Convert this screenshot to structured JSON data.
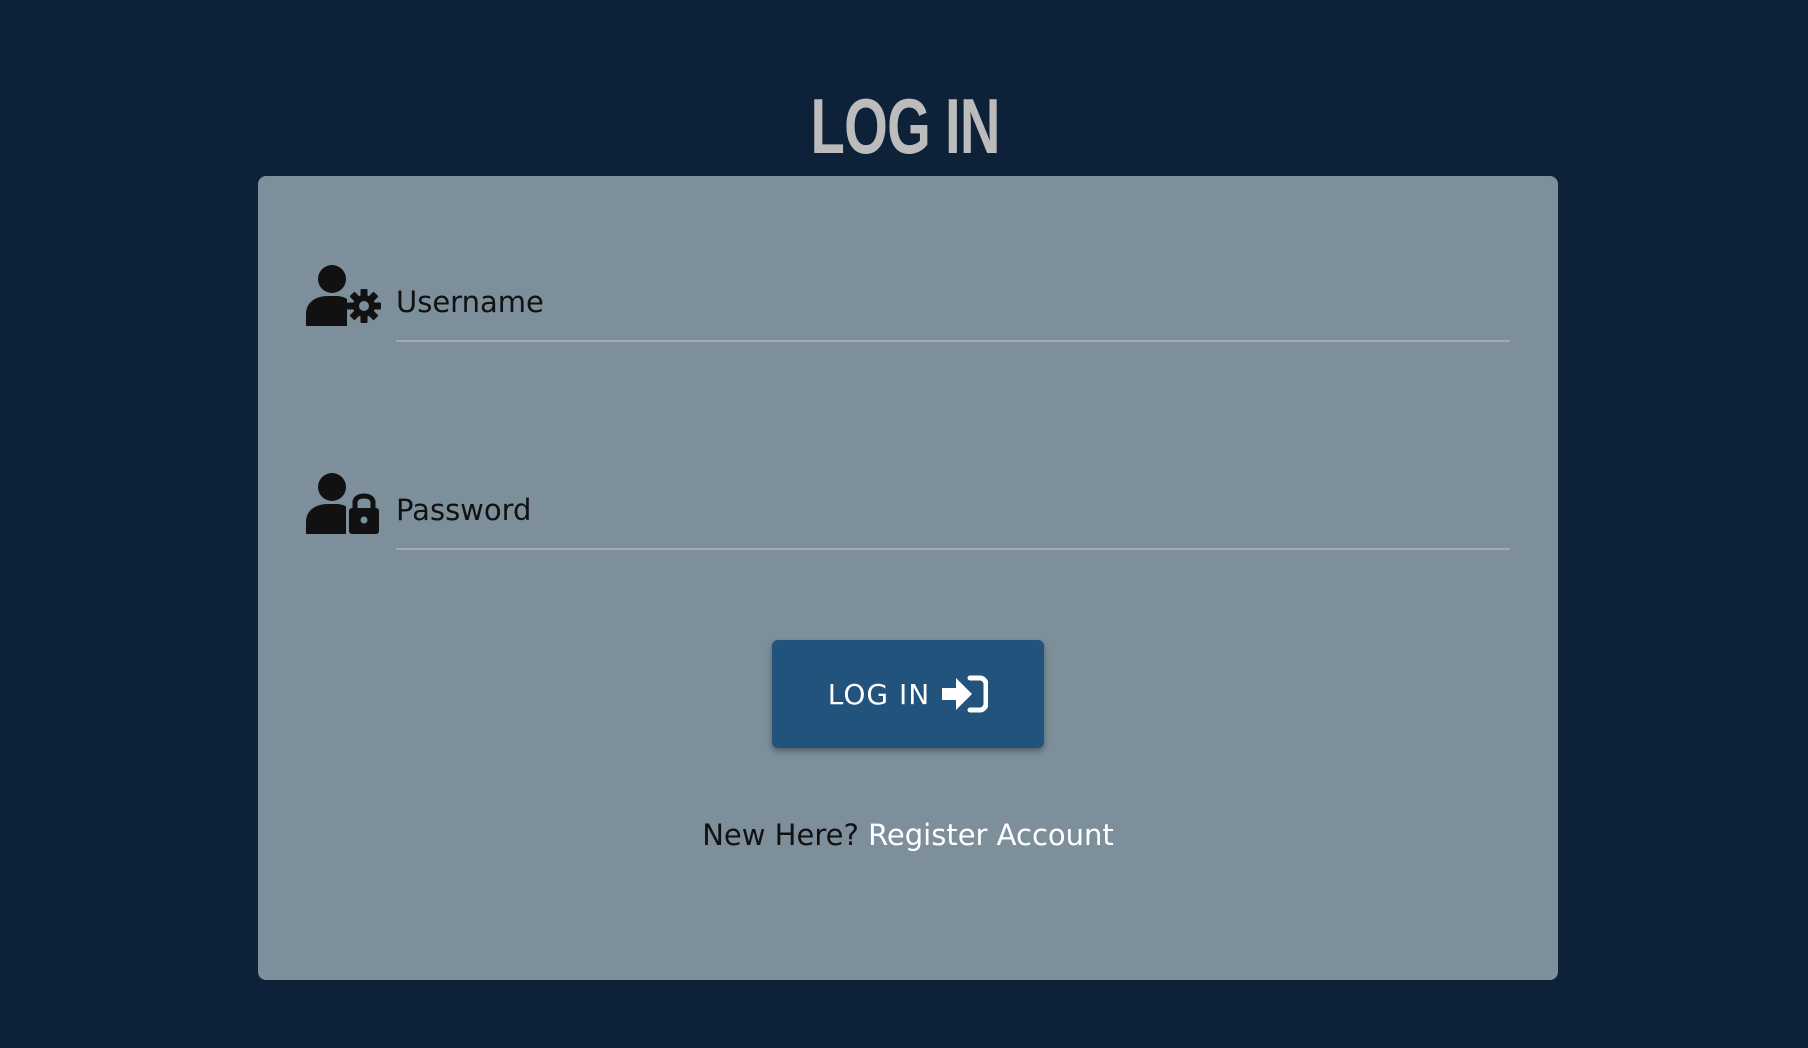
{
  "page": {
    "title": "LOG IN"
  },
  "form": {
    "username": {
      "icon": "user-gear-icon",
      "placeholder": "Username",
      "value": ""
    },
    "password": {
      "icon": "user-lock-icon",
      "placeholder": "Password",
      "value": ""
    },
    "submit": {
      "label": "LOG IN",
      "icon": "sign-in-icon"
    },
    "register": {
      "prompt": "New Here?",
      "link_label": "Register Account"
    }
  },
  "colors": {
    "background": "#0d2238",
    "card": "#7d8f9b",
    "button": "#22537d",
    "title": "#bcbcbc",
    "link": "#ffffff"
  }
}
